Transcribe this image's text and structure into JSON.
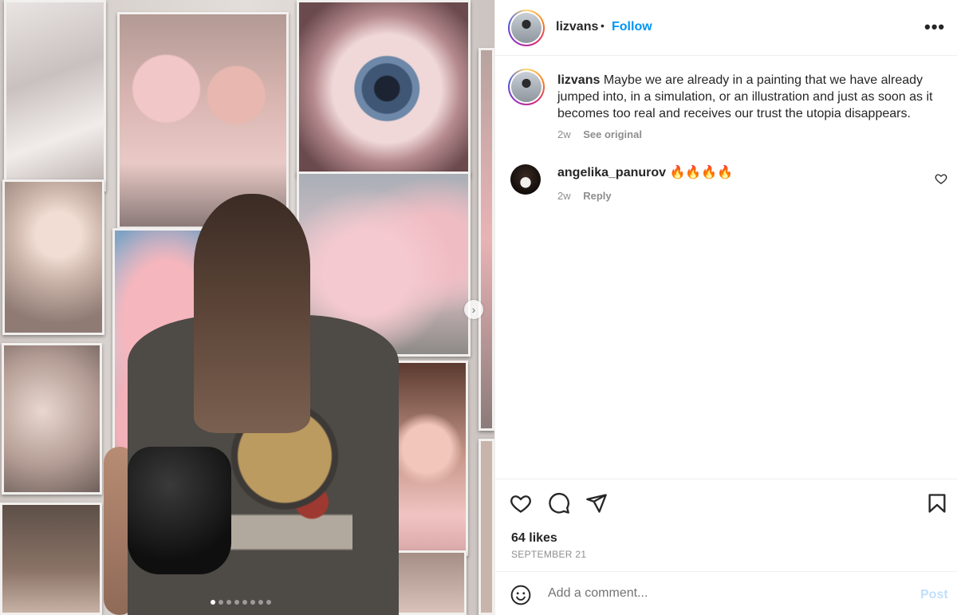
{
  "post": {
    "carousel": {
      "count": 8,
      "active_index": 0,
      "next_icon": "chevron-right-icon"
    },
    "author": {
      "username": "lizvans",
      "separator": "•",
      "follow_label": "Follow"
    },
    "more_icon": "ellipsis-icon",
    "more_label": "•••",
    "caption": {
      "username": "lizvans",
      "text": "Maybe we are already in a painting that we have already jumped into, in a simulation, or an illustration and just as soon as it becomes too real and receives our trust the utopia disappears.",
      "age": "2w",
      "see_original": "See original"
    },
    "comments": [
      {
        "username": "angelika_panurov",
        "text": "🔥🔥🔥🔥",
        "age": "2w",
        "reply_label": "Reply"
      }
    ],
    "actions": {
      "like_icon": "heart-icon",
      "comment_icon": "comment-icon",
      "share_icon": "paper-plane-icon",
      "save_icon": "bookmark-icon"
    },
    "likes": "64 likes",
    "date": "SEPTEMBER 21",
    "add_comment": {
      "placeholder": "Add a comment...",
      "post_label": "Post",
      "emoji_icon": "smiley-icon"
    }
  },
  "colors": {
    "accent": "#0095f6",
    "post_disabled": "#c0dffd",
    "muted": "#8e8e8e",
    "text": "#262626"
  }
}
